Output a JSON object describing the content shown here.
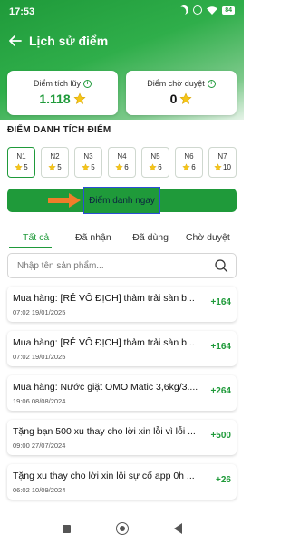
{
  "status_bar": {
    "time": "17:53",
    "battery": "84"
  },
  "header": {
    "title": "Lịch sử điểm"
  },
  "summary": {
    "accumulated": {
      "label": "Điểm tích lũy",
      "value": "1.118"
    },
    "pending": {
      "label": "Điểm chờ duyệt",
      "value": "0"
    }
  },
  "checkin": {
    "section_title": "ĐIỂM DANH TÍCH ĐIỂM",
    "days": [
      {
        "label": "N1",
        "points": "5"
      },
      {
        "label": "N2",
        "points": "5"
      },
      {
        "label": "N3",
        "points": "5"
      },
      {
        "label": "N4",
        "points": "6"
      },
      {
        "label": "N5",
        "points": "6"
      },
      {
        "label": "N6",
        "points": "6"
      },
      {
        "label": "N7",
        "points": "10"
      }
    ],
    "button_label": "Điểm danh ngay"
  },
  "tabs": [
    {
      "label": "Tất cả"
    },
    {
      "label": "Đã nhận"
    },
    {
      "label": "Đã dùng"
    },
    {
      "label": "Chờ duyệt"
    }
  ],
  "search": {
    "placeholder": "Nhập tên sản phẩm..."
  },
  "transactions": [
    {
      "title": "Mua hàng: [RẺ VÔ ĐỊCH] thảm trải sàn b...",
      "date": "07:02 19/01/2025",
      "points": "+164"
    },
    {
      "title": "Mua hàng: [RẺ VÔ ĐỊCH] thảm trải sàn b...",
      "date": "07:02 19/01/2025",
      "points": "+164"
    },
    {
      "title": "Mua hàng: Nước giặt OMO Matic 3,6kg/3....",
      "date": "19:06 08/08/2024",
      "points": "+264"
    },
    {
      "title": "Tặng bạn 500 xu thay cho lời xin lỗi vì lỗi ...",
      "date": "09:00 27/07/2024",
      "points": "+500"
    },
    {
      "title": "Tặng xu thay cho lời xin lỗi sự cố app 0h ...",
      "date": "06:02 10/09/2024",
      "points": "+26"
    }
  ],
  "colors": {
    "brand_green": "#1f9a3a",
    "star": "#f5c518",
    "highlight_border": "#2b4fd6",
    "arrow": "#f07d2a"
  }
}
